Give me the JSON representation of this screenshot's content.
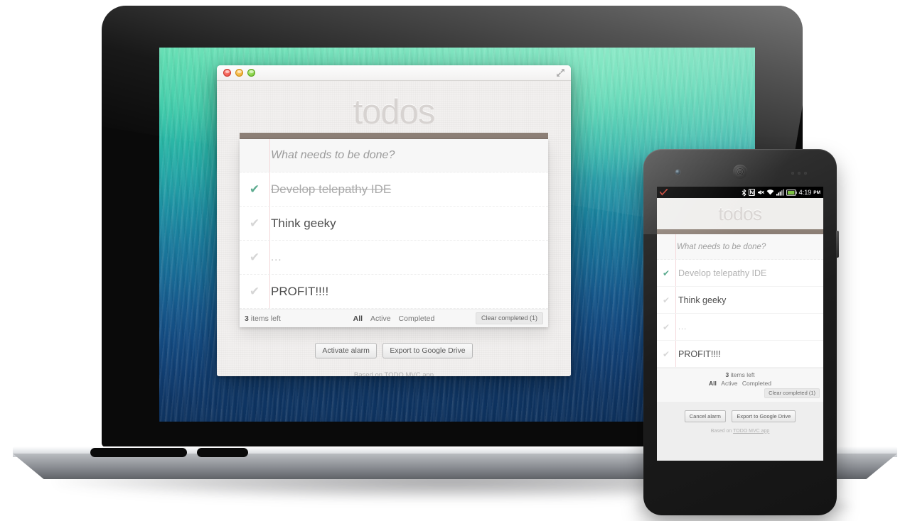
{
  "app": {
    "title": "todos",
    "new_todo_placeholder": "What needs to be done?",
    "items": [
      {
        "label": "Develop telepathy IDE",
        "completed": true,
        "check": "✔"
      },
      {
        "label": "Think geeky",
        "completed": false,
        "check": "✔"
      },
      {
        "label": "...",
        "completed": false,
        "check": "✔"
      },
      {
        "label": "PROFIT!!!!",
        "completed": false,
        "check": "✔"
      }
    ],
    "footer": {
      "count_number": "3",
      "count_text": " items left",
      "filters": [
        {
          "label": "All",
          "selected": true
        },
        {
          "label": "Active",
          "selected": false
        },
        {
          "label": "Completed",
          "selected": false
        }
      ],
      "clear_completed": "Clear completed (1)"
    },
    "desktop_actions": {
      "alarm": "Activate alarm",
      "export": "Export to Google Drive"
    },
    "phone_actions": {
      "alarm": "Cancel alarm",
      "export": "Export to Google Drive"
    },
    "credit_prefix": "Based on ",
    "credit_link": "TODO MVC app"
  },
  "mac_window": {
    "close_label": "close",
    "minimize_label": "minimize",
    "zoom_label": "zoom",
    "expand_label": "full screen"
  },
  "phone": {
    "status_bar": {
      "notification_icon": "check-mark-red",
      "icons": [
        "bluetooth",
        "nfc",
        "silent-mode",
        "wifi",
        "cellular-signal",
        "battery"
      ],
      "time": "4:19",
      "ampm": "PM"
    }
  },
  "colors": {
    "accent_done": "#5dab8f",
    "title_grey": "#d7d3d1",
    "top_bar_brown": "#8a7d74",
    "wallpaper_top": "#3fd0a0",
    "wallpaper_bottom": "#0d2f59",
    "battery_green": "#7dc242",
    "notification_red": "#c0392b"
  }
}
